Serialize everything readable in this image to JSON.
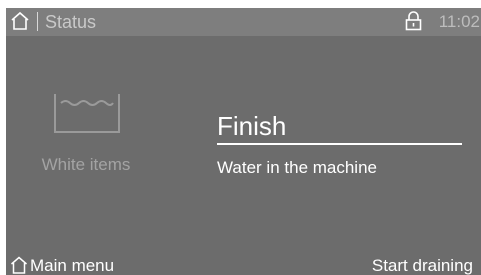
{
  "header": {
    "title": "Status",
    "time": "11:02",
    "home_icon": "home-icon",
    "lock_icon": "lock-icon"
  },
  "program": {
    "icon": "basin-icon",
    "name": "White items"
  },
  "status": {
    "title": "Finish",
    "subtitle": "Water in the machine"
  },
  "footer": {
    "main_menu_label": "Main menu",
    "start_draining_label": "Start draining"
  },
  "colors": {
    "screen_background": "#6c6c6c",
    "header_background": "#7e7e7e",
    "text_primary": "#ffffff",
    "text_dimmed": "#a3a3a3"
  }
}
